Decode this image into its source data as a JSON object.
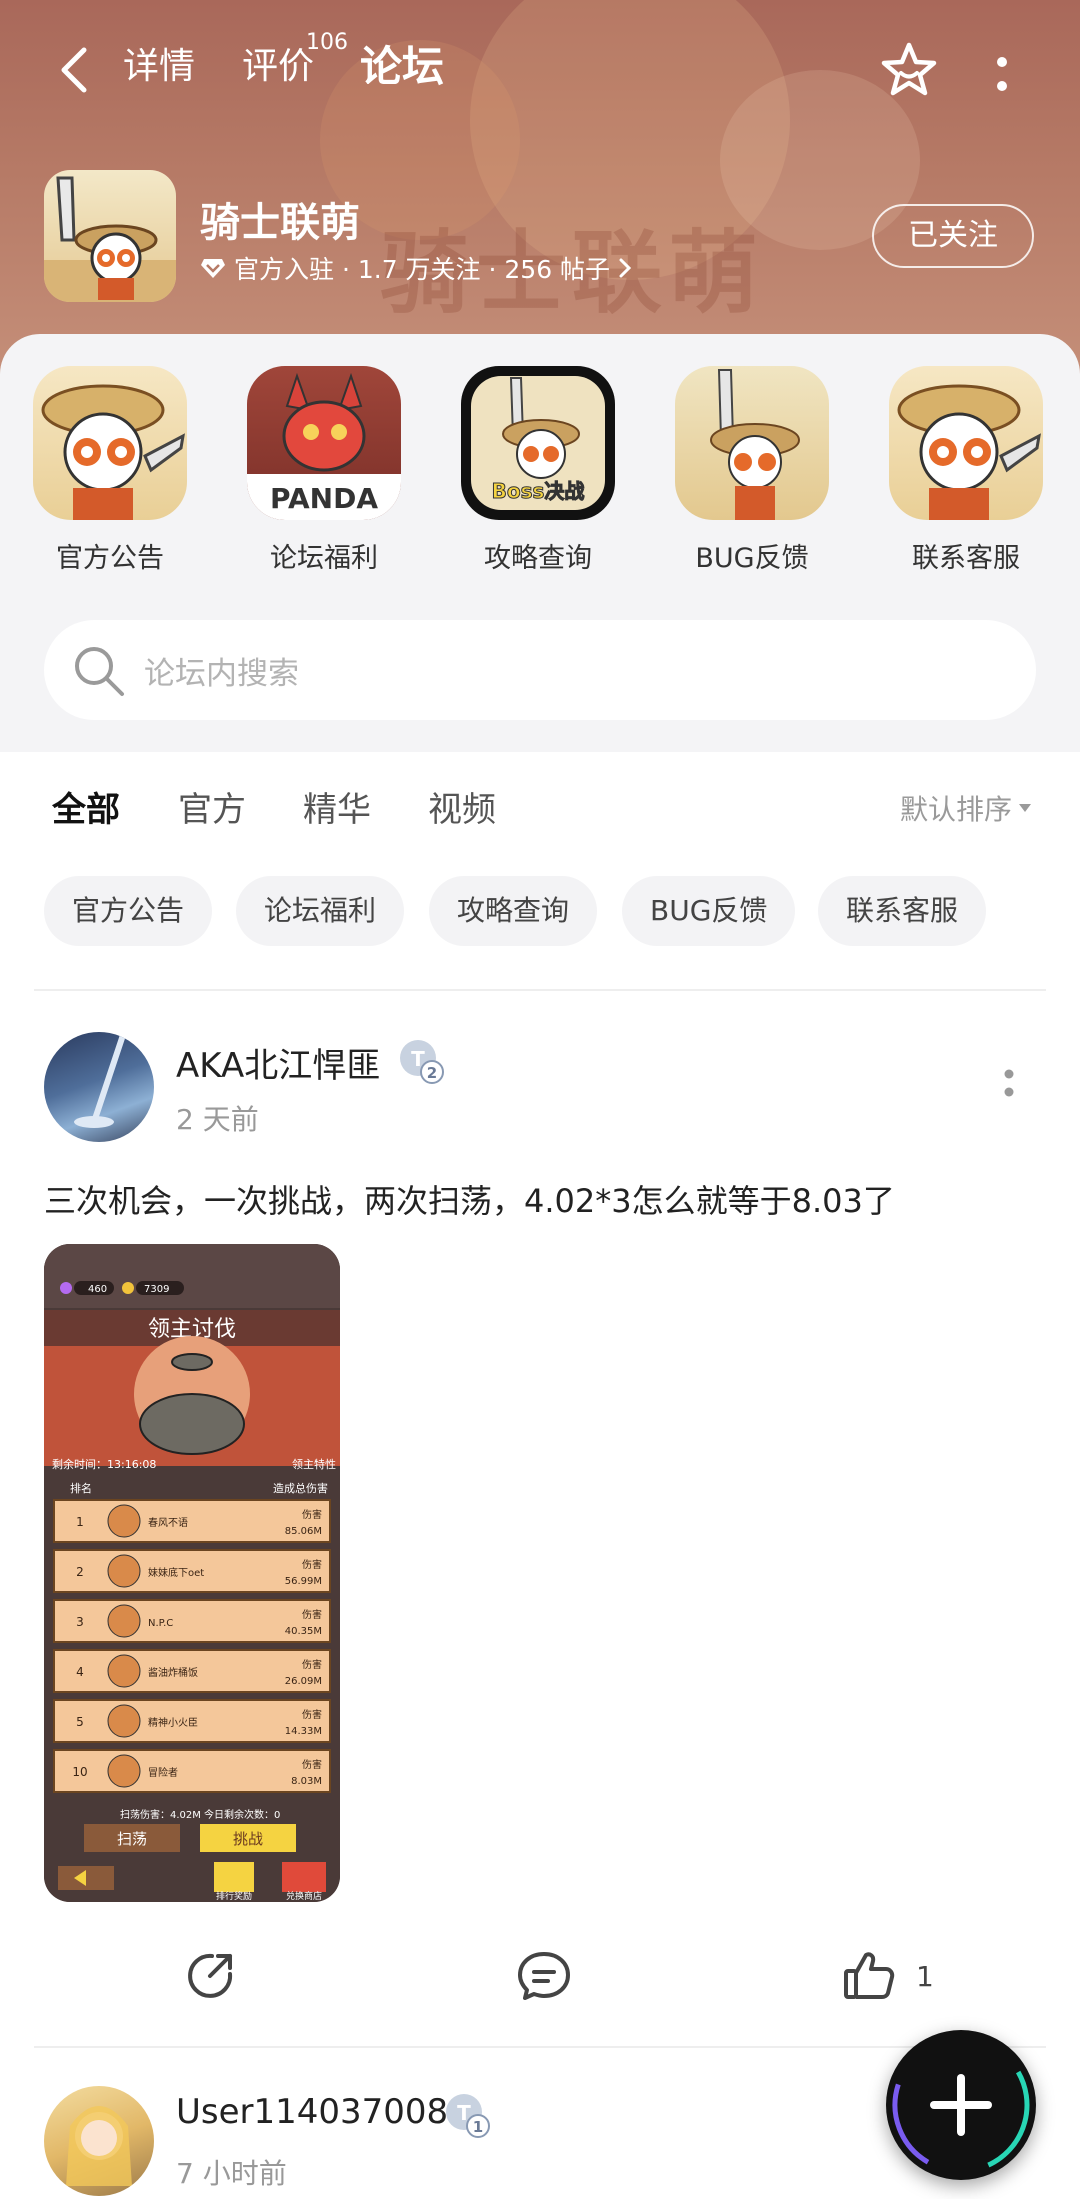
{
  "header": {
    "tabs": [
      "详情",
      "评价",
      "论坛"
    ],
    "review_count": "106",
    "game": {
      "title": "骑士联萌",
      "meta": "官方入驻 · 1.7 万关注 · 256 帖子",
      "follow_label": "已关注"
    }
  },
  "quick_links": [
    {
      "label": "官方公告"
    },
    {
      "label": "论坛福利"
    },
    {
      "label": "攻略查询"
    },
    {
      "label": "BUG反馈"
    },
    {
      "label": "联系客服"
    }
  ],
  "quick_link_art": {
    "panda_text": "PANDA",
    "boss_text": "Boss决战"
  },
  "search": {
    "placeholder": "论坛内搜索"
  },
  "filter_tabs": [
    "全部",
    "官方",
    "精华",
    "视频"
  ],
  "sort_label": "默认排序",
  "chips": [
    "官方公告",
    "论坛福利",
    "攻略查询",
    "BUG反馈",
    "联系客服"
  ],
  "posts": [
    {
      "author": "AKA北江悍匪",
      "level": "2",
      "time": "2 天前",
      "text": "三次机会，一次挑战，两次扫荡，4.02*3怎么就等于8.03了",
      "image": {
        "title": "领主讨伐",
        "currency": [
          "460",
          "7309"
        ],
        "timer": "剩余时间：13:16:08",
        "lord_trait": "领主特性",
        "col_rank": "排名",
        "col_damage": "造成总伤害",
        "rows": [
          {
            "rank": "1",
            "name": "春风不语",
            "damage": "85.06M"
          },
          {
            "rank": "2",
            "name": "妹妹底下oet",
            "damage": "56.99M"
          },
          {
            "rank": "3",
            "name": "N.P.C",
            "damage": "40.35M"
          },
          {
            "rank": "4",
            "name": "酱油炸桶饭",
            "damage": "26.09M"
          },
          {
            "rank": "5",
            "name": "精神小火臣",
            "damage": "14.33M"
          },
          {
            "rank": "10",
            "name": "冒险者",
            "damage": "8.03M"
          }
        ],
        "damage_label": "伤害",
        "sweep_damage": "扫荡伤害：4.02M",
        "remaining": "今日剩余次数：0",
        "sweep_btn": "扫荡",
        "challenge_btn": "挑战",
        "rank_reward": "排行奖励",
        "exchange": "兑换商店"
      },
      "likes": "1"
    },
    {
      "author": "User114037008",
      "level": "1",
      "time": "7 小时前"
    }
  ],
  "colors": {
    "accent": "#27d3b0",
    "banner": "#b67a66",
    "fab": "#111111"
  }
}
